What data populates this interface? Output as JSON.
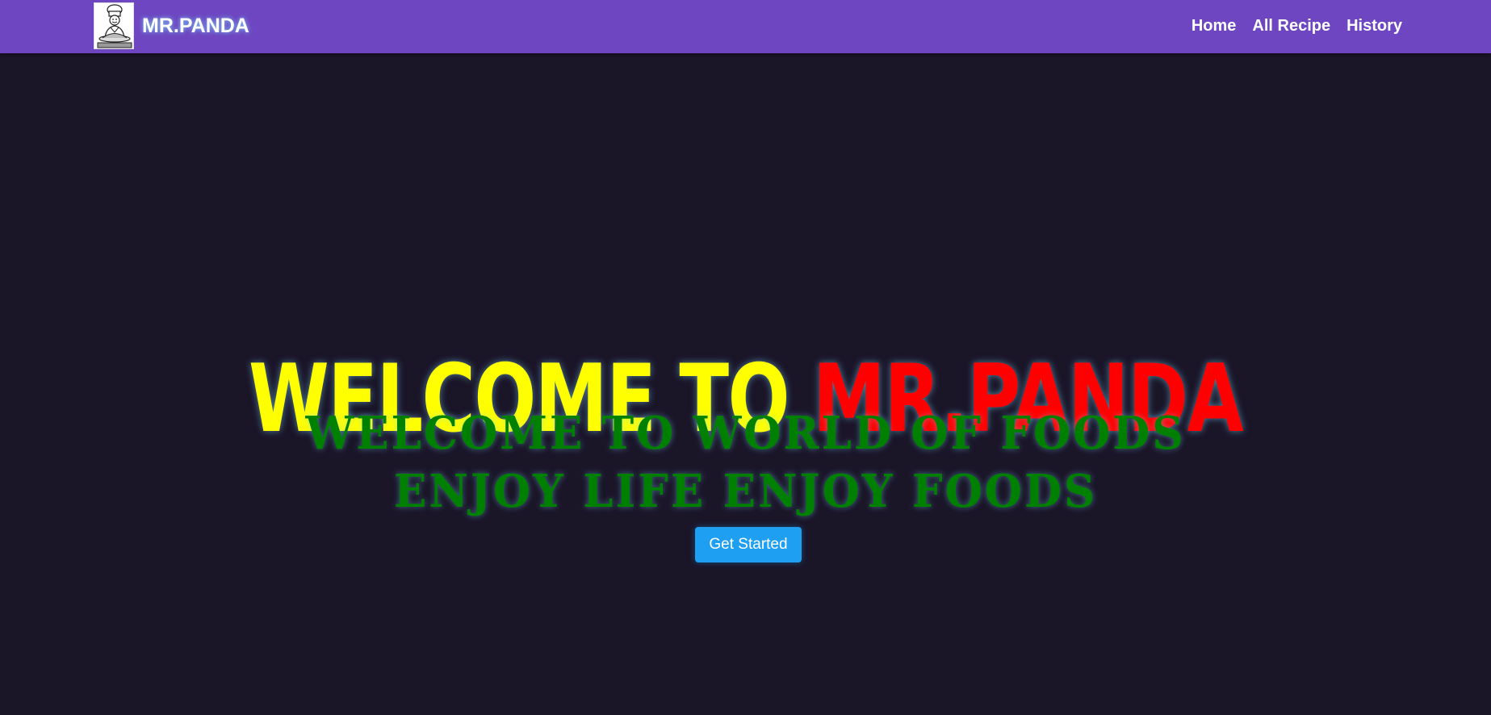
{
  "navbar": {
    "brand_name": "MR.PANDA",
    "logo_icon": "chef-logo-icon",
    "links": [
      {
        "label": "Home"
      },
      {
        "label": "All Recipe"
      },
      {
        "label": "History"
      }
    ],
    "background_color": "#6f46c1"
  },
  "hero": {
    "headline_part1": "WELCOME TO ",
    "headline_part2": "MR.PANDA",
    "subline1": "WELCOME TO WORLD OF FOODS",
    "subline2": "ENJOY LIFE ENJOY FOODS",
    "cta_label": "Get Started",
    "colors": {
      "headline_part1": "#ffff00",
      "headline_part2": "#ff0000",
      "sublines": "#008000",
      "cta": "#1e9ff2",
      "background": "#1b1528"
    }
  }
}
